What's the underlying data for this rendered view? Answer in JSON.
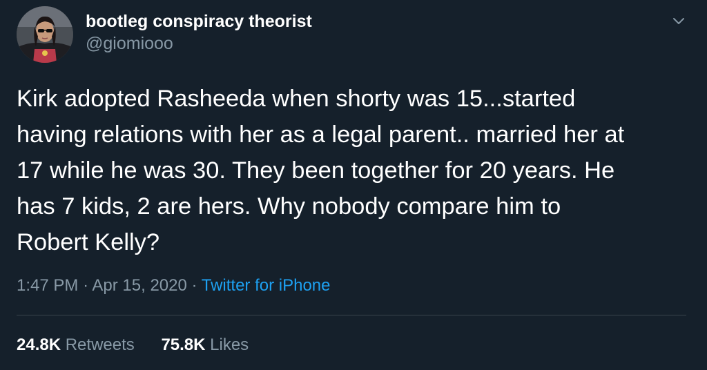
{
  "author": {
    "display_name": "bootleg conspiracy theorist",
    "handle": "@giomiooo"
  },
  "tweet": {
    "text_lines": [
      "Kirk adopted Rasheeda when shorty was 15...started",
      "having relations with her as a legal parent.. married her at",
      "17 while he was 30. They been together for 20 years. He",
      "has 7 kids, 2 are hers. Why nobody compare him to",
      "Robert Kelly?"
    ],
    "time": "1:47 PM",
    "separator": "·",
    "date": "Apr 15, 2020",
    "source": "Twitter for iPhone"
  },
  "stats": {
    "retweets_count": "24.8K",
    "retweets_label": "Retweets",
    "likes_count": "75.8K",
    "likes_label": "Likes"
  },
  "icons": {
    "menu": "chevron-down-icon"
  },
  "colors": {
    "background": "#15202b",
    "text": "#ffffff",
    "secondary": "#8899a6",
    "link": "#1da1f2",
    "divider": "#38444d"
  }
}
